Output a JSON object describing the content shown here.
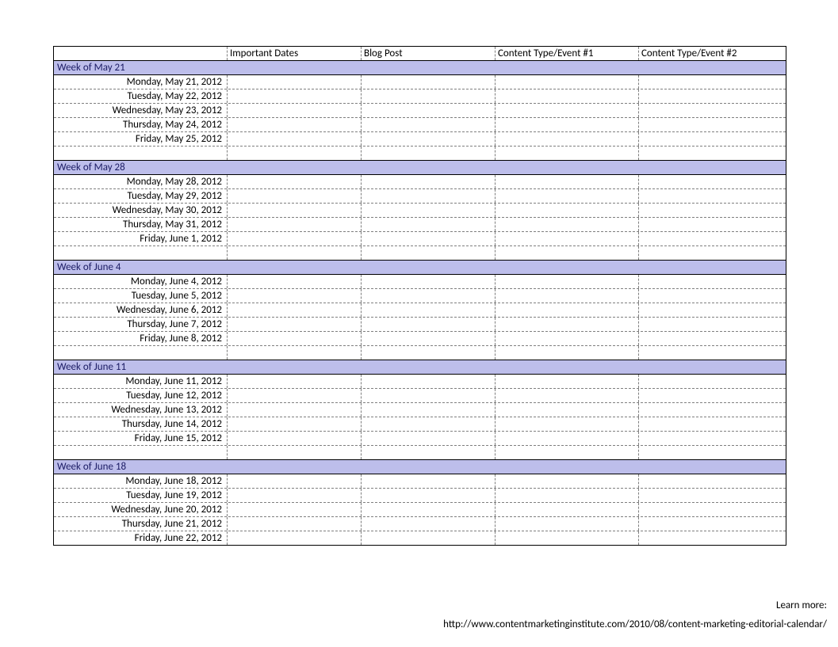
{
  "headers": {
    "col0": "",
    "col1": "Important Dates",
    "col2": "Blog Post",
    "col3": "Content Type/Event #1",
    "col4": "Content Type/Event #2"
  },
  "weeks": [
    {
      "label": "Week of May 21",
      "days": [
        "Monday, May 21, 2012",
        "Tuesday, May 22, 2012",
        "Wednesday, May 23, 2012",
        "Thursday, May 24, 2012",
        "Friday, May 25, 2012"
      ]
    },
    {
      "label": "Week of May 28",
      "days": [
        "Monday, May 28, 2012",
        "Tuesday, May 29, 2012",
        "Wednesday, May 30, 2012",
        "Thursday, May 31, 2012",
        "Friday, June 1, 2012"
      ]
    },
    {
      "label": "Week of June 4",
      "days": [
        "Monday, June 4, 2012",
        "Tuesday, June 5, 2012",
        "Wednesday, June 6, 2012",
        "Thursday, June 7, 2012",
        "Friday, June 8, 2012"
      ]
    },
    {
      "label": "Week of June 11",
      "days": [
        "Monday, June 11, 2012",
        "Tuesday, June 12, 2012",
        "Wednesday, June 13, 2012",
        "Thursday, June 14, 2012",
        "Friday, June 15, 2012"
      ]
    },
    {
      "label": "Week of June 18",
      "days": [
        "Monday, June 18, 2012",
        "Tuesday, June 19, 2012",
        "Wednesday, June 20, 2012",
        "Thursday, June 21, 2012",
        "Friday, June 22, 2012"
      ]
    }
  ],
  "footer": {
    "learn": "Learn more:",
    "url": "http://www.contentmarketinginstitute.com/2010/08/content-marketing-editorial-calendar/"
  }
}
